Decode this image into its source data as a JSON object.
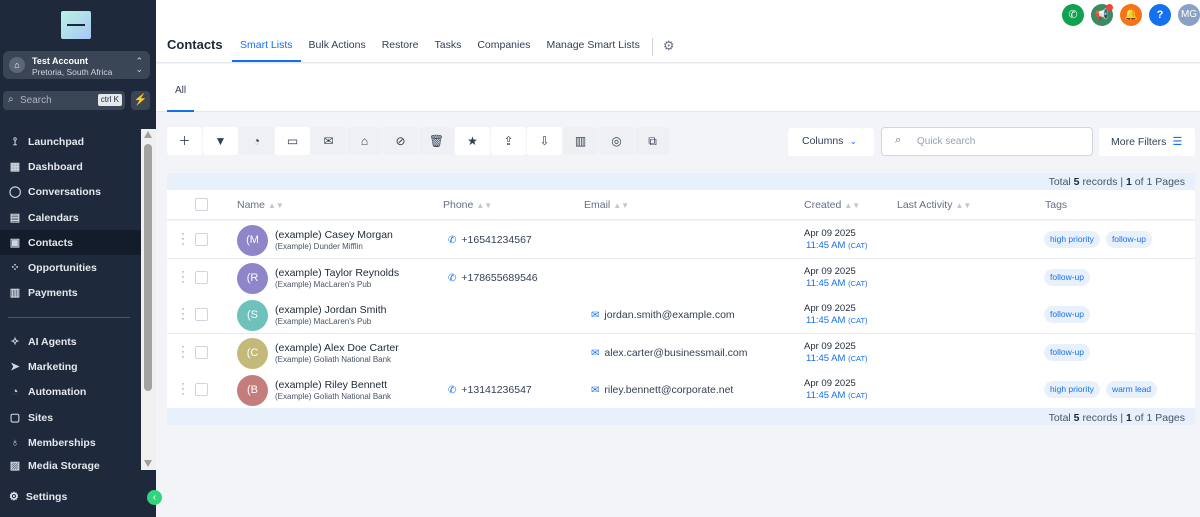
{
  "sidebar": {
    "account": {
      "name": "Test Account",
      "location": "Pretoria, South Africa"
    },
    "search": {
      "placeholder": "Search",
      "shortcut": "ctrl K"
    },
    "nav": [
      {
        "label": "Launchpad",
        "icon": "rocket-icon"
      },
      {
        "label": "Dashboard",
        "icon": "dashboard-icon"
      },
      {
        "label": "Conversations",
        "icon": "chat-icon"
      },
      {
        "label": "Calendars",
        "icon": "calendar-icon"
      },
      {
        "label": "Contacts",
        "icon": "contacts-icon",
        "active": true
      },
      {
        "label": "Opportunities",
        "icon": "opportunities-icon"
      },
      {
        "label": "Payments",
        "icon": "payments-icon"
      }
    ],
    "nav2": [
      {
        "label": "AI Agents",
        "icon": "ai-icon"
      },
      {
        "label": "Marketing",
        "icon": "send-icon"
      },
      {
        "label": "Automation",
        "icon": "automation-icon"
      },
      {
        "label": "Sites",
        "icon": "sites-icon"
      },
      {
        "label": "Memberships",
        "icon": "membership-icon"
      },
      {
        "label": "Media Storage",
        "icon": "media-icon"
      }
    ],
    "settings_label": "Settings"
  },
  "header": {
    "title": "Contacts",
    "tabs": [
      "Smart Lists",
      "Bulk Actions",
      "Restore",
      "Tasks",
      "Companies",
      "Manage Smart Lists"
    ],
    "active_tab": "Smart Lists",
    "user_initials": "MG"
  },
  "subtabs": {
    "active": "All"
  },
  "toolbar": {
    "columns_label": "Columns",
    "quick_search_placeholder": "Quick search",
    "more_filters_label": "More Filters"
  },
  "table": {
    "records_prefix": "Total",
    "records_total": "5",
    "records_mid": "records |",
    "page_current": "1",
    "page_suffix": "of 1 Pages",
    "columns": [
      "Name",
      "Phone",
      "Email",
      "Created",
      "Last Activity",
      "Tags"
    ],
    "rows": [
      {
        "initial": "(M",
        "color": "#8e86c9",
        "name": "(example) Casey Morgan",
        "company": "(Example) Dunder Mifflin",
        "phone": "+16541234567",
        "email": "",
        "date": "Apr 09 2025",
        "time": "11:45 AM",
        "tz": "(CAT)",
        "tags": [
          "high priority",
          "follow-up"
        ]
      },
      {
        "initial": "(R",
        "color": "#8e86c9",
        "name": "(example) Taylor Reynolds",
        "company": "(Example) MacLaren's Pub",
        "phone": "+178655689546",
        "email": "",
        "date": "Apr 09 2025",
        "time": "11:45 AM",
        "tz": "(CAT)",
        "tags": [
          "follow-up"
        ]
      },
      {
        "initial": "(S",
        "color": "#6fc2bb",
        "name": "(example) Jordan Smith",
        "company": "(Example) MacLaren's Pub",
        "phone": "",
        "email": "jordan.smith@example.com",
        "date": "Apr 09 2025",
        "time": "11:45 AM",
        "tz": "(CAT)",
        "tags": [
          "follow-up"
        ]
      },
      {
        "initial": "(C",
        "color": "#c3b97a",
        "name": "(example) Alex Doe Carter",
        "company": "(Example) Goliath National Bank",
        "phone": "",
        "email": "alex.carter@businessmail.com",
        "date": "Apr 09 2025",
        "time": "11:45 AM",
        "tz": "(CAT)",
        "tags": [
          "follow-up"
        ]
      },
      {
        "initial": "(B",
        "color": "#c57d7b",
        "name": "(example) Riley Bennett",
        "company": "(Example) Goliath National Bank",
        "phone": "+13141236547",
        "email": "riley.bennett@corporate.net",
        "date": "Apr 09 2025",
        "time": "11:45 AM",
        "tz": "(CAT)",
        "tags": [
          "high priority",
          "warm lead"
        ]
      }
    ]
  },
  "colors": {
    "accent": "#1570ef",
    "sidebar_bg": "#1e2a3b",
    "tag_bg": "#e8f1fb"
  }
}
